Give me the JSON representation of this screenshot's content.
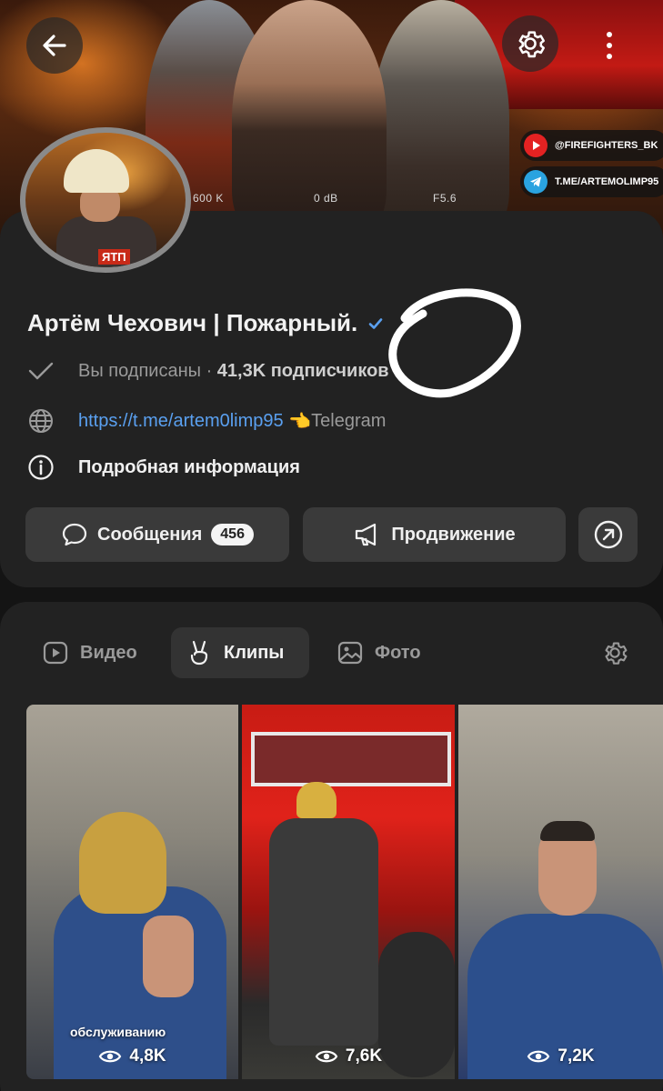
{
  "cover": {
    "stats": [
      "600 K",
      "0 dB",
      "F5.6"
    ],
    "youtube_handle": "@FIREFIGHTERS_BK",
    "telegram_handle": "T.ME/ARTEMOLIMP95"
  },
  "avatar": {
    "badge_text": "ЯТП"
  },
  "profile": {
    "name": "Артём Чехович | Пожарный.",
    "subscribed_label": "Вы подписаны",
    "separator": "·",
    "subscribers": "41,3K подписчиков",
    "link_text": "https://t.me/artem0limp95",
    "link_emoji": "👈",
    "link_suffix": "Telegram",
    "details_label": "Подробная информация"
  },
  "actions": {
    "messages_label": "Сообщения",
    "messages_count": "456",
    "promote_label": "Продвижение"
  },
  "tabs": [
    {
      "label": "Видео"
    },
    {
      "label": "Клипы"
    },
    {
      "label": "Фото"
    }
  ],
  "clips": [
    {
      "caption": "обслуживанию",
      "views": "4,8K"
    },
    {
      "caption": "",
      "views": "7,6K"
    },
    {
      "caption": "",
      "views": "7,2K"
    }
  ],
  "colors": {
    "accent_link": "#5aa0f0",
    "verified": "#5aa0f0",
    "card": "#222222"
  }
}
